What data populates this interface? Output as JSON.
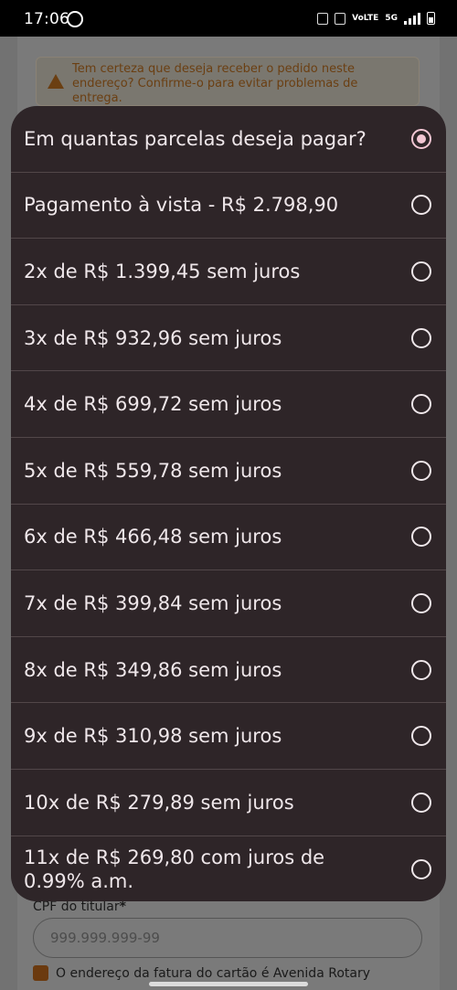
{
  "status_bar": {
    "time": "17:06",
    "net_label": "5G",
    "volte_label": "VoLTE"
  },
  "warning": {
    "text": "Tem certeza que deseja receber o pedido neste endereço? Confirme-o para evitar problemas de entrega."
  },
  "form": {
    "cpf_label": "CPF do titular",
    "cpf_required": "*",
    "cpf_placeholder": "999.999.999-99",
    "billing_text": "O endereço da fatura do cartão é Avenida Rotary"
  },
  "dialog": {
    "title": "Em quantas parcelas deseja pagar?",
    "options": [
      "Pagamento à vista - R$ 2.798,90",
      "2x de R$ 1.399,45 sem juros",
      "3x de R$ 932,96 sem juros",
      "4x de R$ 699,72 sem juros",
      "5x de R$ 559,78 sem juros",
      "6x de R$ 466,48 sem juros",
      "7x de R$ 399,84 sem juros",
      "8x de R$ 349,86 sem juros",
      "9x de R$ 310,98 sem juros",
      "10x de R$ 279,89 sem juros",
      "11x de R$ 269,80 com juros de 0.99% a.m."
    ]
  }
}
